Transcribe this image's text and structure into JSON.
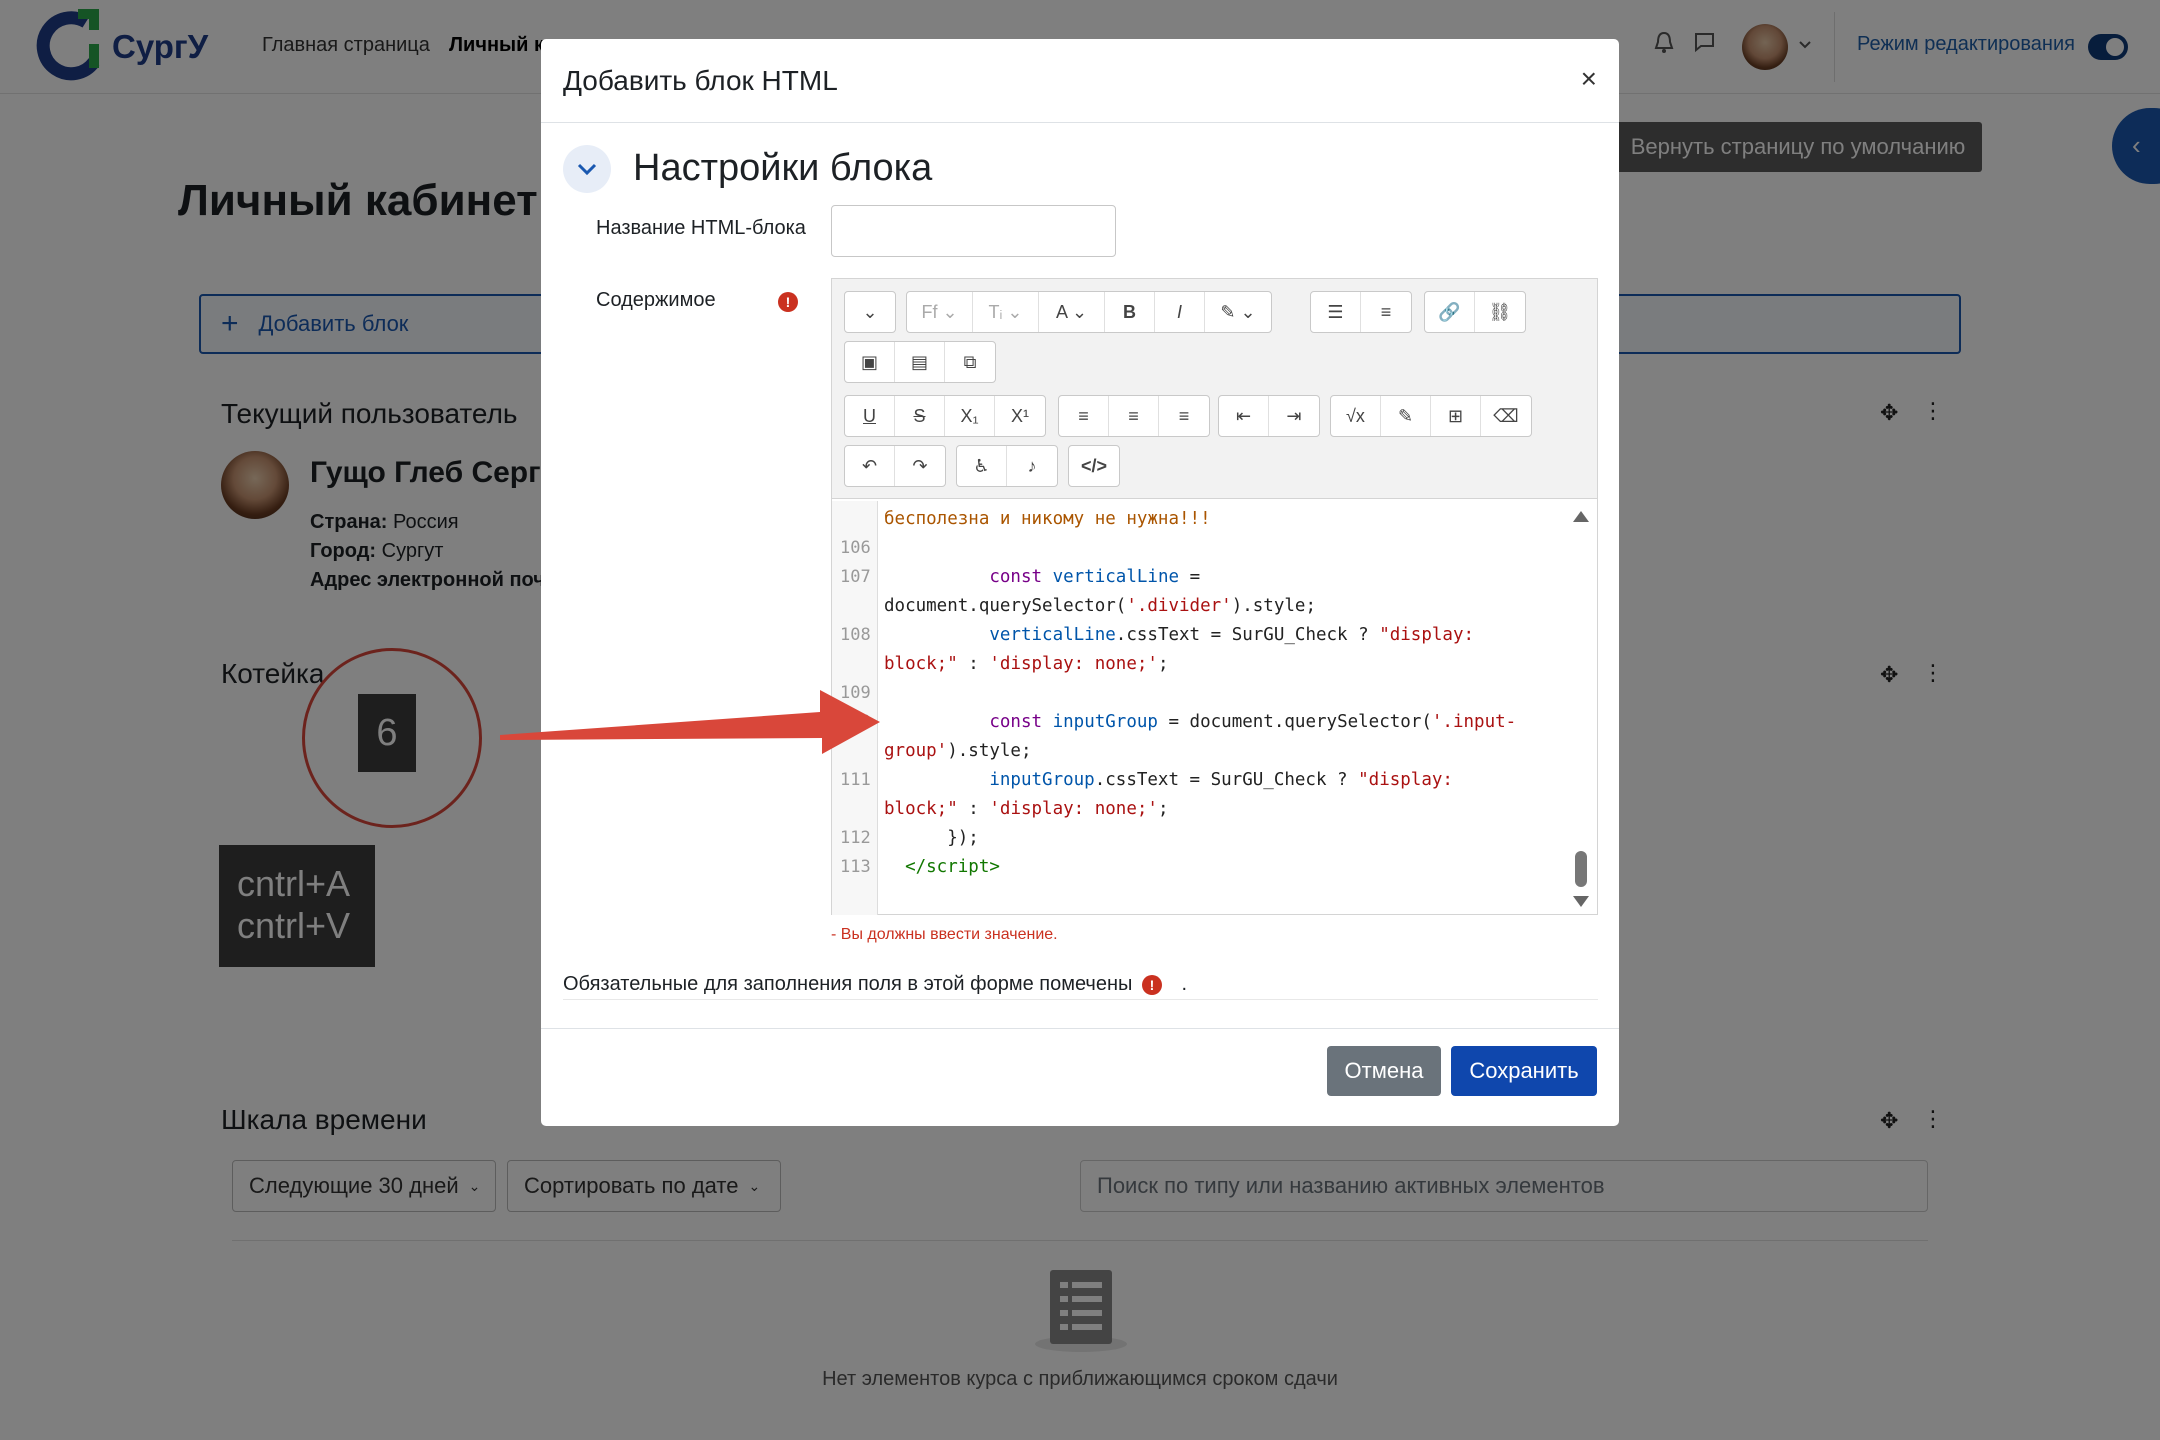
{
  "nav": {
    "logo_text": "СургУ",
    "links": [
      "Главная страница",
      "Личный к"
    ],
    "edit_mode_label": "Режим редактирования"
  },
  "page": {
    "reset_button": "Вернуть страницу по умолчанию",
    "title": "Личный кабинет",
    "add_block": "Добавить блок"
  },
  "user_block": {
    "title": "Текущий пользователь",
    "name": "Гущо Глеб Серге",
    "country_label": "Страна:",
    "country": "Россия",
    "city_label": "Город:",
    "city": "Сургут",
    "email_label": "Адрес электронной поч"
  },
  "cat_block": {
    "title": "Котейка"
  },
  "annotation": {
    "step_number": "6",
    "keys_line1": "cntrl+A",
    "keys_line2": "cntrl+V",
    "color": "#d9473a"
  },
  "timeline": {
    "title": "Шкала времени",
    "filter": "Следующие 30 дней",
    "sort": "Сортировать по дате",
    "search_placeholder": "Поиск по типу или названию активных элементов",
    "empty_text": "Нет элементов курса с приближающимся сроком сдачи"
  },
  "modal": {
    "title": "Добавить блок HTML",
    "close": "×",
    "section_title": "Настройки блока",
    "name_label": "Название HTML-блока",
    "content_label": "Содержимое",
    "error": "- Вы должны ввести значение.",
    "required_note": "Обязательные для заполнения поля в этой форме помечены",
    "required_note_end": ".",
    "cancel": "Отмена",
    "save": "Сохранить"
  },
  "code": {
    "lines": [
      {
        "n": "",
        "html": "<span class=\"cmt\">бесполезна и никому не нужна!!!</span>"
      },
      {
        "n": "106",
        "html": ""
      },
      {
        "n": "107",
        "html": "          <span class=\"kw\">const</span> <span class=\"var\">verticalLine</span> ="
      },
      {
        "n": "",
        "html": "document.querySelector(<span class=\"str\">'.divider'</span>).style;"
      },
      {
        "n": "108",
        "html": "          <span class=\"var\">verticalLine</span>.cssText = SurGU_Check ? <span class=\"str\">\"display:</span>"
      },
      {
        "n": "",
        "html": "<span class=\"str\">block;\"</span> : <span class=\"str\">'display: none;'</span>;"
      },
      {
        "n": "109",
        "html": ""
      },
      {
        "n": "110",
        "html": "          <span class=\"kw\">const</span> <span class=\"var\">inputGroup</span> = document.querySelector(<span class=\"str\">'.input-</span>"
      },
      {
        "n": "",
        "html": "<span class=\"str\">group'</span>).style;"
      },
      {
        "n": "111",
        "html": "          <span class=\"var\">inputGroup</span>.cssText = SurGU_Check ? <span class=\"str\">\"display:</span>"
      },
      {
        "n": "",
        "html": "<span class=\"str\">block;\"</span> : <span class=\"str\">'display: none;'</span>;"
      },
      {
        "n": "112",
        "html": "      });"
      },
      {
        "n": "113",
        "html": "  <span class=\"tag\">&lt;/script&gt;</span>"
      }
    ]
  }
}
